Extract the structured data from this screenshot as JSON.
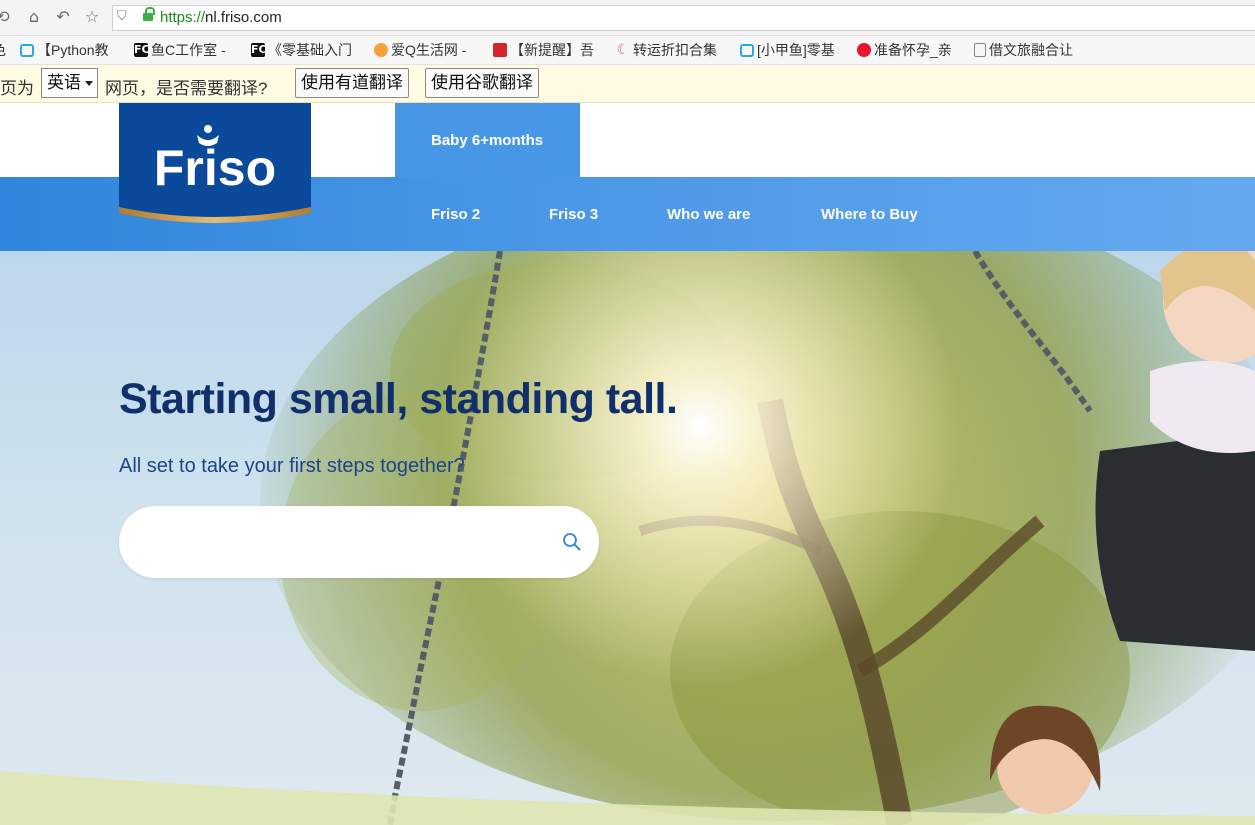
{
  "browser": {
    "url_scheme": "https://",
    "url_host": "nl.friso.com",
    "icons": [
      "back-icon",
      "home-icon",
      "undo-icon",
      "star-icon",
      "shield-icon",
      "lock-icon"
    ]
  },
  "bookmarks": [
    {
      "label": "色",
      "icon": ""
    },
    {
      "label": "【Python教",
      "icon": "bilibili-icon"
    },
    {
      "label": "鱼C工作室 -",
      "icon": "fc-icon"
    },
    {
      "label": "《零基础入门",
      "icon": "fc-icon"
    },
    {
      "label": "爱Q生活网 -",
      "icon": "mascot-icon"
    },
    {
      "label": "【新提醒】吾",
      "icon": "red-badge-icon"
    },
    {
      "label": "转运折扣合集",
      "icon": "moon-icon"
    },
    {
      "label": "[小甲鱼]零基",
      "icon": "bilibili-icon"
    },
    {
      "label": "准备怀孕_亲",
      "icon": "weibo-icon"
    },
    {
      "label": "借文旅融合让",
      "icon": "page-icon"
    }
  ],
  "translate_bar": {
    "prefix": "页为",
    "language": "英语",
    "question": "网页，是否需要翻译?",
    "btn_youdao": "使用有道翻译",
    "btn_google": "使用谷歌翻译"
  },
  "site": {
    "logo_text": "Friso",
    "nav_active": "Baby 6+months",
    "nav": [
      "Friso 2",
      "Friso 3",
      "Who we are",
      "Where to Buy"
    ],
    "colors": {
      "navy": "#11306b",
      "nav_blue": "#4896e6",
      "logo_blue": "#0b4a9a",
      "gold": "#c8963e"
    }
  },
  "hero": {
    "title": "Starting small, standing tall.",
    "subtitle": "All set to take your first steps together?",
    "search_placeholder": ""
  }
}
